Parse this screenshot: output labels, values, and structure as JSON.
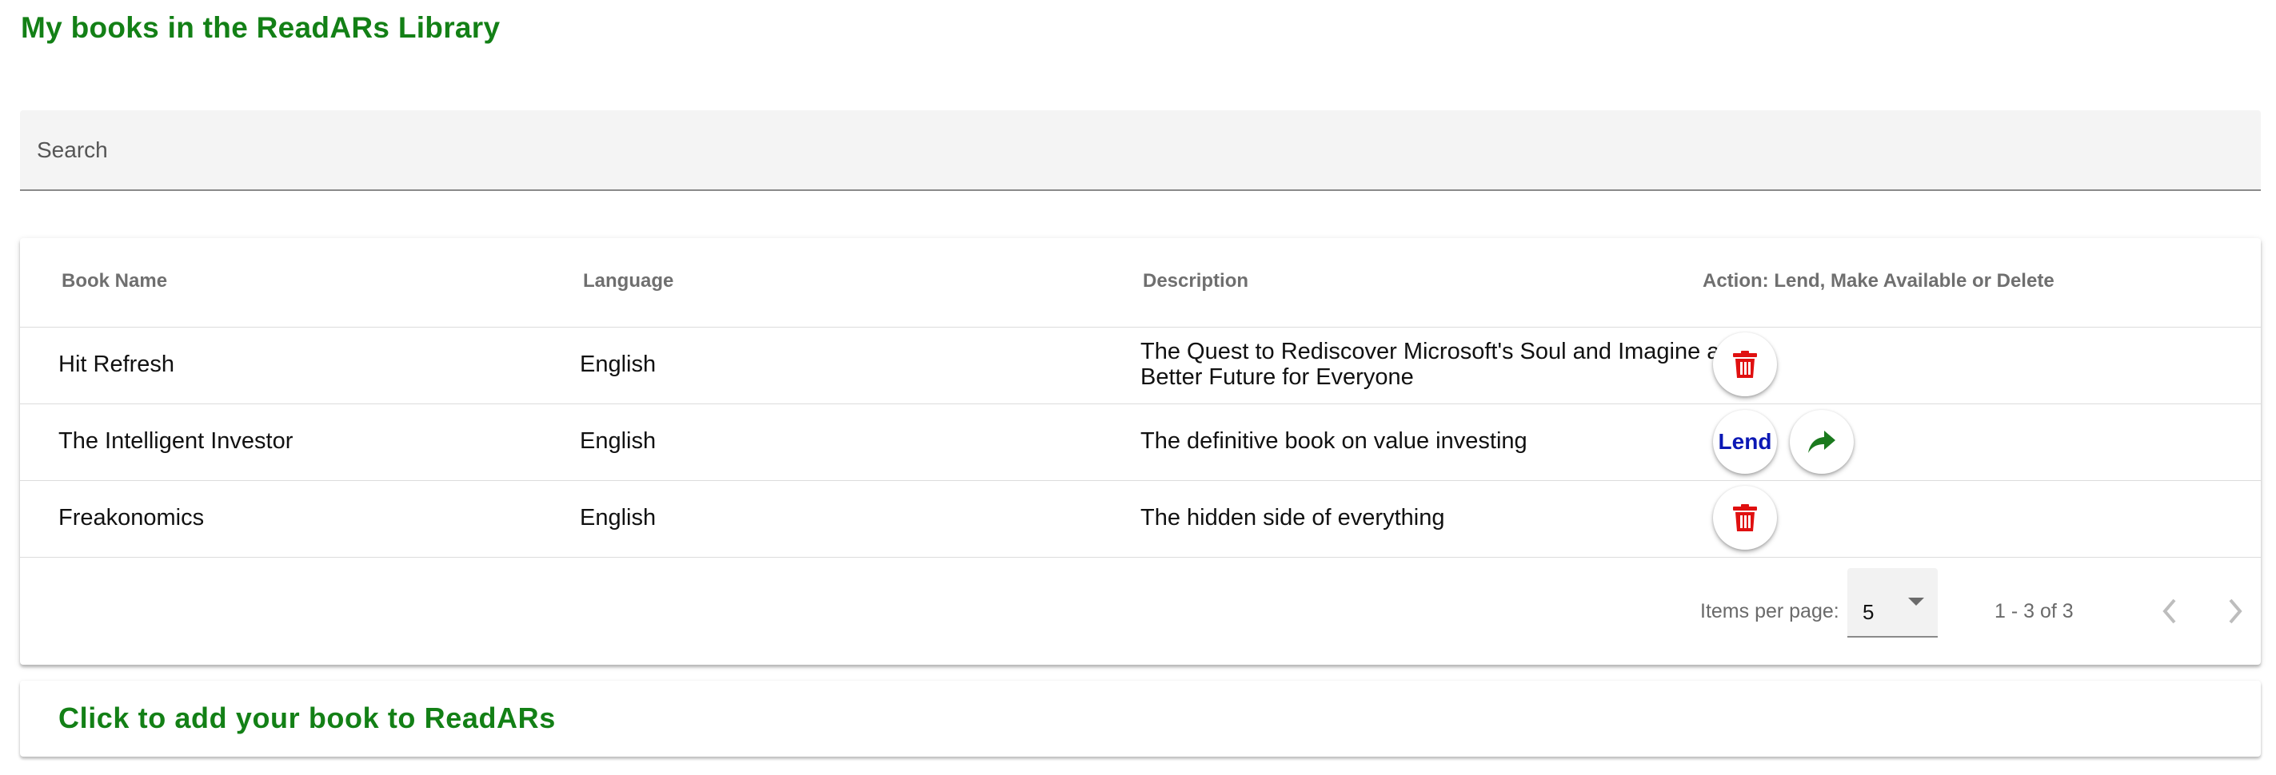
{
  "page": {
    "title": "My books in the ReadARs Library"
  },
  "search": {
    "placeholder": "Search",
    "value": ""
  },
  "table": {
    "headers": {
      "name": "Book Name",
      "language": "Language",
      "description": "Description",
      "action": "Action: Lend, Make Available or Delete"
    },
    "rows": [
      {
        "name": "Hit Refresh",
        "language": "English",
        "description": "The Quest to Rediscover Microsoft's Soul and Imagine a Better Future for Everyone",
        "actions": [
          "delete-icon"
        ]
      },
      {
        "name": "The Intelligent Investor",
        "language": "English",
        "description": "The definitive book on value investing",
        "actions": [
          "lend",
          "share-icon"
        ],
        "lend_label": "Lend"
      },
      {
        "name": "Freakonomics",
        "language": "English",
        "description": "The hidden side of everything",
        "actions": [
          "delete-icon"
        ]
      }
    ]
  },
  "paginator": {
    "items_per_page_label": "Items per page:",
    "page_size": "5",
    "range_label": "1 - 3 of 3"
  },
  "add_book": {
    "label": "Click to add your book to ReadARs"
  },
  "colors": {
    "brand_green": "#138016",
    "delete_red": "#e01010",
    "lend_blue": "#0b18b5",
    "share_green": "#1b7a1e"
  }
}
